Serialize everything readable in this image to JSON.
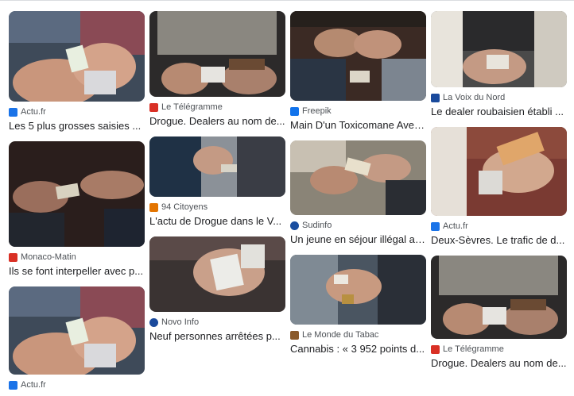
{
  "results": [
    [
      {
        "source": "Actu.fr",
        "title": "Les 5 plus grosses saisies ...",
        "favicon": "actu-icon",
        "fav_color": "#1a73e8"
      },
      {
        "source": "Monaco-Matin",
        "title": "Ils se font interpeller avec p...",
        "favicon": "monaco-matin-icon",
        "fav_color": "#d93025"
      },
      {
        "source": "Actu.fr",
        "title": "",
        "favicon": "actu-icon",
        "fav_color": "#1a73e8"
      }
    ],
    [
      {
        "source": "Le Télégramme",
        "title": "Drogue. Dealers au nom de...",
        "favicon": "letelegramme-icon",
        "fav_color": "#d93025"
      },
      {
        "source": "94 Citoyens",
        "title": "L'actu de Drogue dans le V...",
        "favicon": "94citoyens-icon",
        "fav_color": "#e37400"
      },
      {
        "source": "Novo Info",
        "title": "Neuf personnes arrêtées p...",
        "favicon": "novoinfo-icon",
        "fav_color": "#1a4a9c"
      }
    ],
    [
      {
        "source": "Freepik",
        "title": "Main D'un Toxicomane Avec...",
        "favicon": "freepik-icon",
        "fav_color": "#1273eb"
      },
      {
        "source": "Sudinfo",
        "title": "Un jeune en séjour illégal ar...",
        "favicon": "sudinfo-icon",
        "fav_color": "#1a4ea0"
      },
      {
        "source": "Le Monde du Tabac",
        "title": "Cannabis : « 3 952 points d...",
        "favicon": "lemondedutabac-icon",
        "fav_color": "#8a5a2b"
      }
    ],
    [
      {
        "source": "La Voix du Nord",
        "title": "Le dealer roubaisien établi ...",
        "favicon": "lavoixdunord-icon",
        "fav_color": "#1a4a9c"
      },
      {
        "source": "Actu.fr",
        "title": "Deux-Sèvres. Le trafic de d...",
        "favicon": "actu-icon",
        "fav_color": "#1a73e8"
      },
      {
        "source": "Le Télégramme",
        "title": "Drogue. Dealers au nom de...",
        "favicon": "letelegramme-icon",
        "fav_color": "#d93025"
      }
    ]
  ]
}
